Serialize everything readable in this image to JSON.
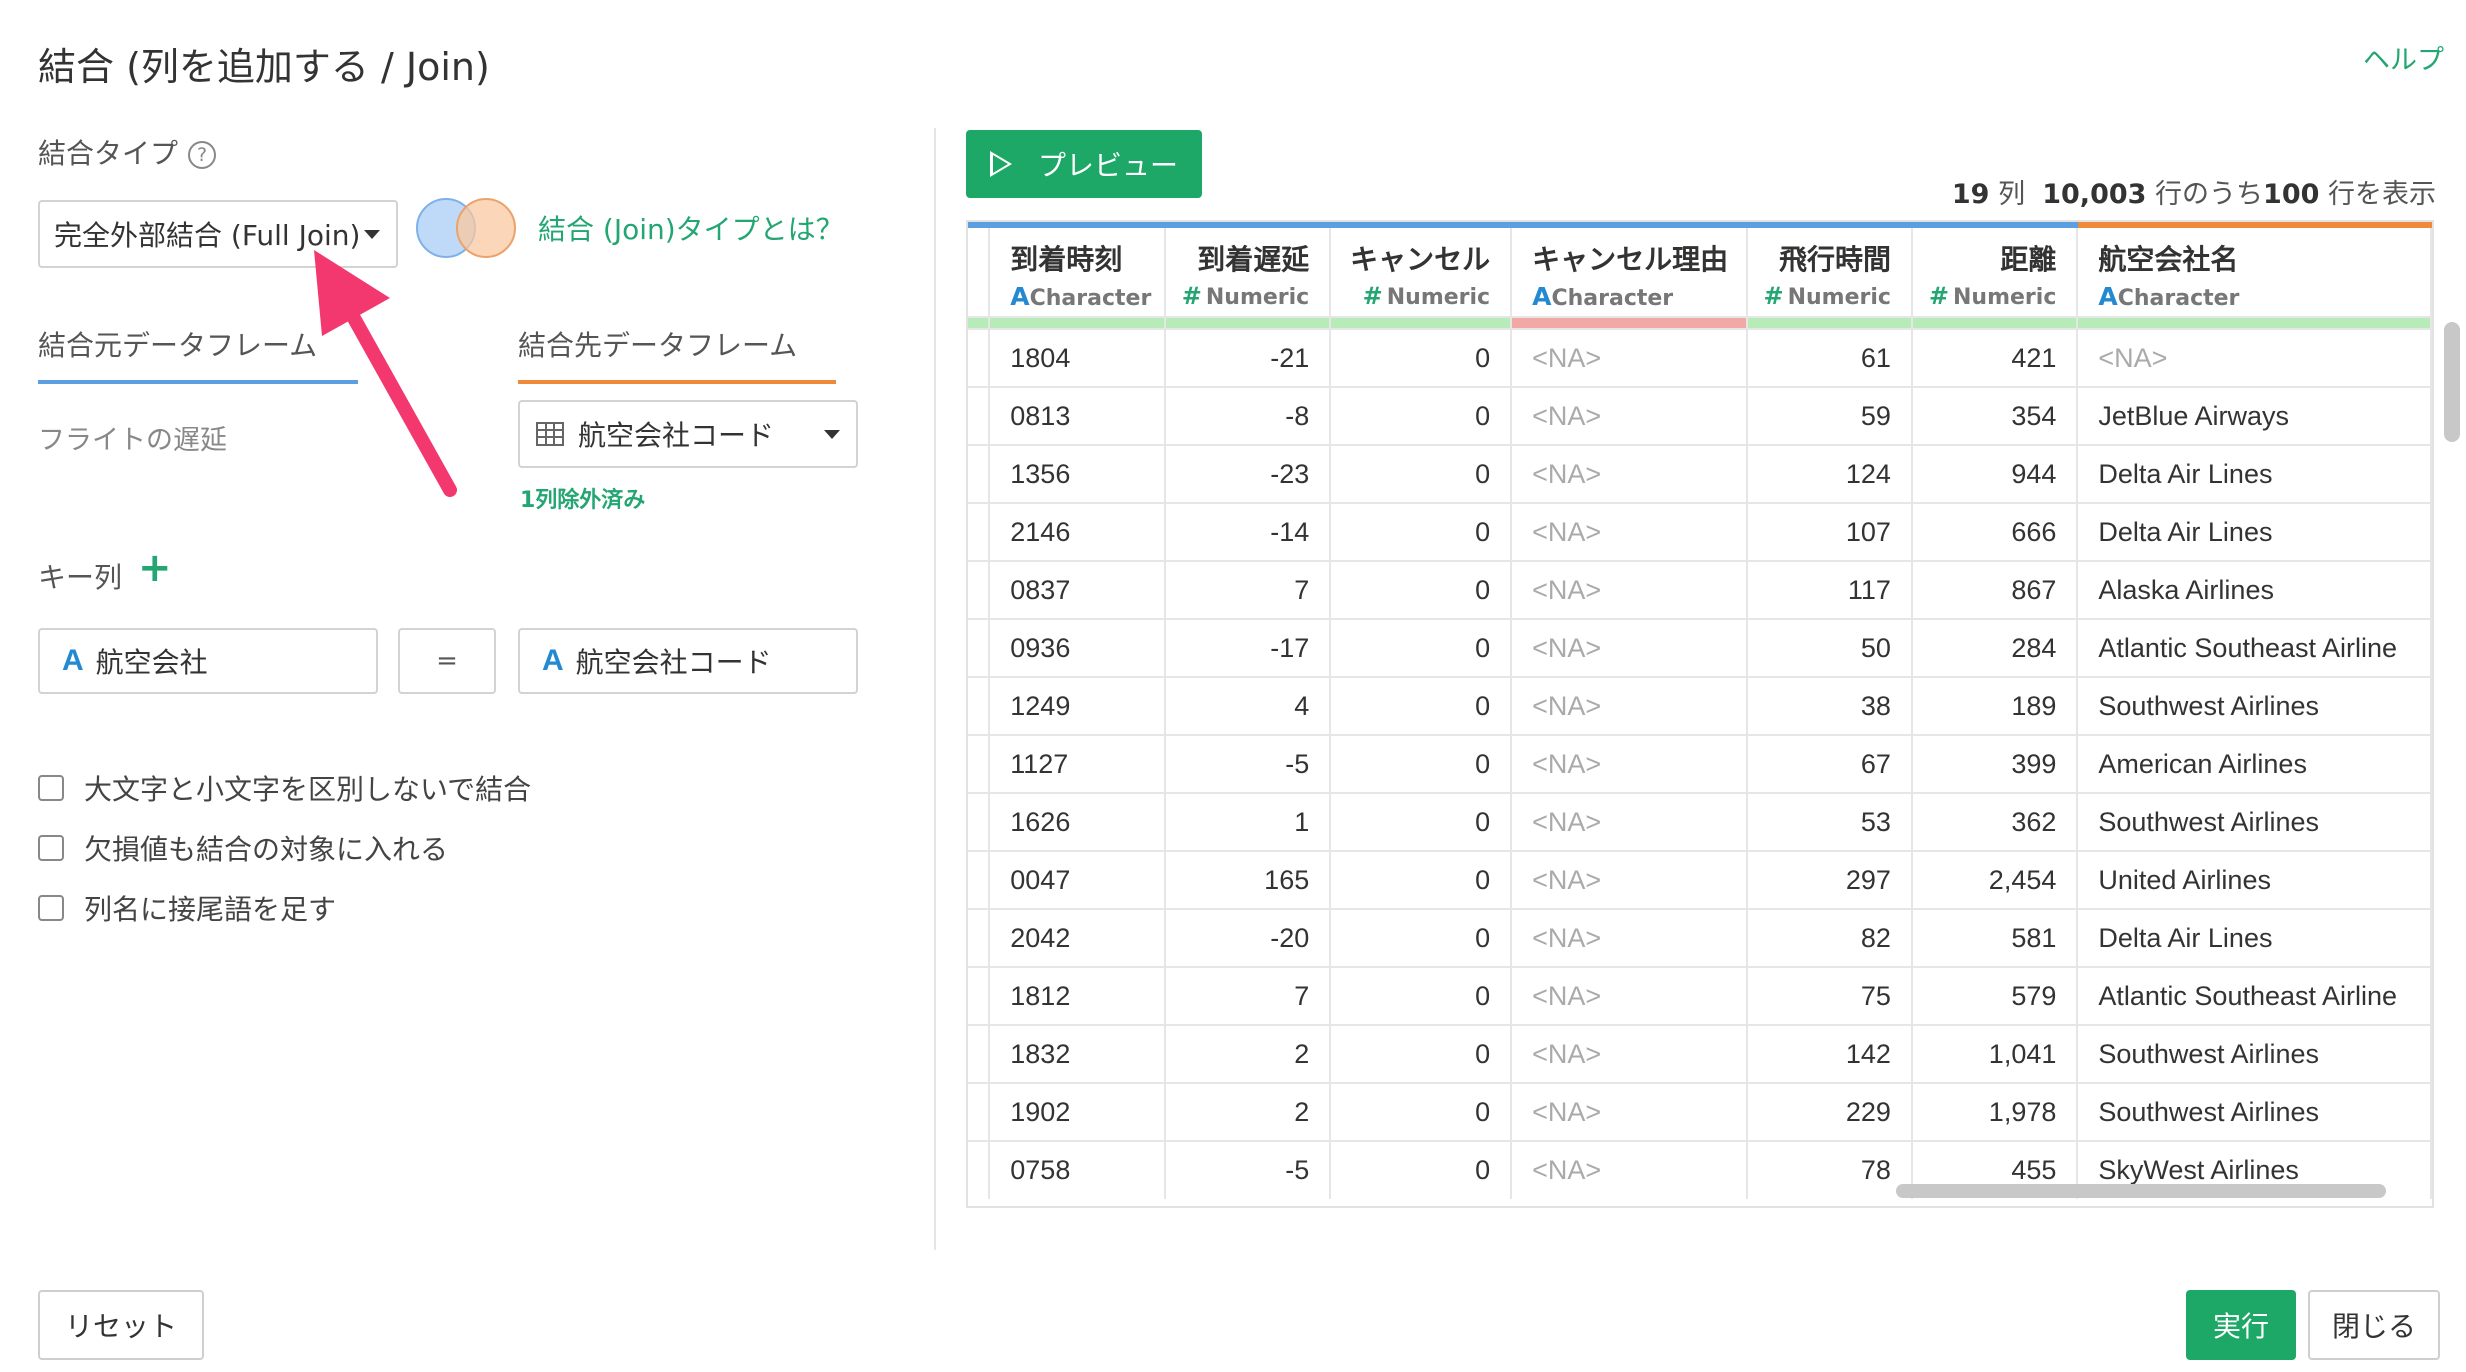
{
  "header": {
    "title": "結合 (列を追加する / Join)",
    "help": "ヘルプ"
  },
  "join_type": {
    "label": "結合タイプ",
    "help_icon": "?",
    "selected": "完全外部結合 (Full Join)",
    "about_link": "結合 (Join)タイプとは？"
  },
  "dataframes": {
    "source_tab": "結合元データフレーム",
    "target_tab": "結合先データフレーム",
    "source_name": "フライトの遅延",
    "target_selected": "航空会社コード",
    "excluded_note": "1列除外済み"
  },
  "keys": {
    "label": "キー列",
    "add_icon": "+",
    "source_key": "航空会社",
    "target_key": "航空会社コード",
    "equals": "="
  },
  "options": [
    "大文字と小文字を区別しないで結合",
    "欠損値も結合の対象に入れる",
    "列名に接尾語を足す"
  ],
  "preview": {
    "button": "プレビュー",
    "cols_count": "19",
    "cols_unit": "列",
    "total_rows": "10,003",
    "rows_mid": "行のうち",
    "shown_rows": "100",
    "rows_suffix": "行を表示"
  },
  "table": {
    "columns": [
      {
        "name": "到着時刻",
        "type_icon": "A",
        "type": "Character"
      },
      {
        "name": "到着遅延",
        "type_icon": "#",
        "type": "Numeric"
      },
      {
        "name": "キャンセル",
        "type_icon": "#",
        "type": "Numeric"
      },
      {
        "name": "キャンセル理由",
        "type_icon": "A",
        "type": "Character"
      },
      {
        "name": "飛行時間",
        "type_icon": "#",
        "type": "Numeric"
      },
      {
        "name": "距離",
        "type_icon": "#",
        "type": "Numeric"
      },
      {
        "name": "航空会社名",
        "type_icon": "A",
        "type": "Character"
      }
    ],
    "rows": [
      [
        "1804",
        "-21",
        "0",
        "<NA>",
        "61",
        "421",
        "<NA>"
      ],
      [
        "0813",
        "-8",
        "0",
        "<NA>",
        "59",
        "354",
        "JetBlue Airways"
      ],
      [
        "1356",
        "-23",
        "0",
        "<NA>",
        "124",
        "944",
        "Delta Air Lines"
      ],
      [
        "2146",
        "-14",
        "0",
        "<NA>",
        "107",
        "666",
        "Delta Air Lines"
      ],
      [
        "0837",
        "7",
        "0",
        "<NA>",
        "117",
        "867",
        "Alaska Airlines"
      ],
      [
        "0936",
        "-17",
        "0",
        "<NA>",
        "50",
        "284",
        "Atlantic Southeast Airline"
      ],
      [
        "1249",
        "4",
        "0",
        "<NA>",
        "38",
        "189",
        "Southwest Airlines"
      ],
      [
        "1127",
        "-5",
        "0",
        "<NA>",
        "67",
        "399",
        "American Airlines"
      ],
      [
        "1626",
        "1",
        "0",
        "<NA>",
        "53",
        "362",
        "Southwest Airlines"
      ],
      [
        "0047",
        "165",
        "0",
        "<NA>",
        "297",
        "2,454",
        "United Airlines"
      ],
      [
        "2042",
        "-20",
        "0",
        "<NA>",
        "82",
        "581",
        "Delta Air Lines"
      ],
      [
        "1812",
        "7",
        "0",
        "<NA>",
        "75",
        "579",
        "Atlantic Southeast Airline"
      ],
      [
        "1832",
        "2",
        "0",
        "<NA>",
        "142",
        "1,041",
        "Southwest Airlines"
      ],
      [
        "1902",
        "2",
        "0",
        "<NA>",
        "229",
        "1,978",
        "Southwest Airlines"
      ],
      [
        "0758",
        "-5",
        "0",
        "<NA>",
        "78",
        "455",
        "SkyWest Airlines"
      ]
    ]
  },
  "footer": {
    "reset": "リセット",
    "run": "実行",
    "close": "閉じる"
  },
  "colors": {
    "accent": "#1ea868",
    "source": "#5b9fe0",
    "target": "#ef8a3c",
    "annotation_arrow": "#f2386e"
  }
}
